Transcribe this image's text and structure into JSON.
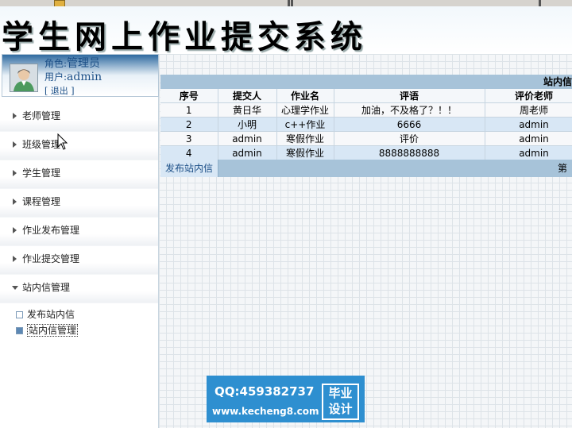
{
  "banner": {
    "title": "学生网上作业提交系统"
  },
  "user": {
    "role_label": "角色:",
    "role_value": "管理员",
    "user_label": "用户:",
    "user_value": "admin",
    "logout": "[ 退出 ]"
  },
  "menu": {
    "items": [
      {
        "label": "老师管理"
      },
      {
        "label": "班级管理"
      },
      {
        "label": "学生管理"
      },
      {
        "label": "课程管理"
      },
      {
        "label": "作业发布管理"
      },
      {
        "label": "作业提交管理"
      },
      {
        "label": "站内信管理"
      }
    ],
    "sub": [
      {
        "label": "发布站内信"
      },
      {
        "label": "站内信管理"
      }
    ]
  },
  "panel": {
    "title": "站内信",
    "columns": [
      "序号",
      "提交人",
      "作业名",
      "评语",
      "评价老师"
    ],
    "rows": [
      [
        "1",
        "黄日华",
        "心理学作业",
        "加油，不及格了？！！",
        "周老师"
      ],
      [
        "2",
        "小明",
        "c++作业",
        "6666",
        "admin"
      ],
      [
        "3",
        "admin",
        "寒假作业",
        "评价",
        "admin"
      ],
      [
        "4",
        "admin",
        "寒假作业",
        "8888888888",
        "admin"
      ]
    ],
    "footer_button": "发布站内信",
    "footer_page": "第"
  },
  "watermark": {
    "qq": "QQ:459382737",
    "site": "www.kecheng8.com",
    "badge_line1": "毕业",
    "badge_line2": "设计"
  },
  "colors": {
    "header_bar": "#a7c3d9",
    "row_alt": "#d8e7f5",
    "link": "#1c4f87",
    "watermark_bg": "#2e8fd0"
  }
}
